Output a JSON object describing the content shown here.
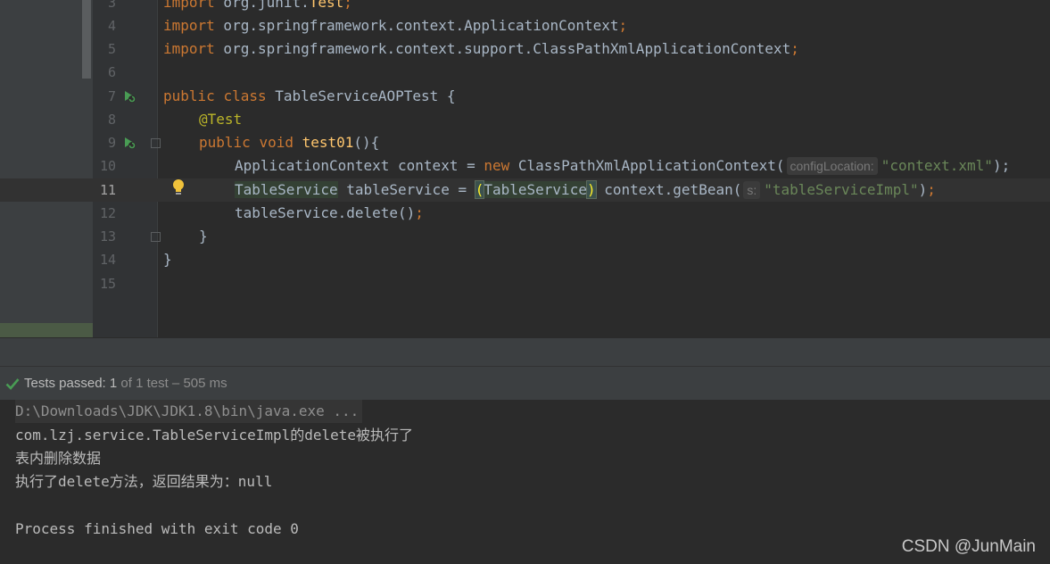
{
  "editor": {
    "line_numbers": [
      "3",
      "4",
      "5",
      "6",
      "7",
      "8",
      "9",
      "10",
      "11",
      "12",
      "13",
      "14",
      "15"
    ],
    "line3_kw": "import",
    "line3_pkg": " org.junit.",
    "line3_cls": "Test",
    "line3_semi": ";",
    "line4_kw": "import",
    "line4_rest": " org.springframework.context.ApplicationContext",
    "line4_semi": ";",
    "line5_kw": "import",
    "line5_rest": " org.springframework.context.support.ClassPathXmlApplicationContext",
    "line5_semi": ";",
    "line7_kw1": "public",
    "line7_kw2": "class",
    "line7_rest": " TableServiceAOPTest {",
    "line8_ann": "@Test",
    "line9_kw1": "public",
    "line9_kw2": "void",
    "line9_fn": "test01",
    "line9_rest": "(){",
    "line10_a": "ApplicationContext context = ",
    "line10_new": "new",
    "line10_b": " ClassPathXmlApplicationContext(",
    "line10_hint": "configLocation:",
    "line10_str": "\"context.xml\"",
    "line10_end": ");",
    "line11_type": "TableService",
    "line11_a": " tableService = ",
    "line11_open": "(",
    "line11_cast": "TableService",
    "line11_close": ")",
    "line11_b": " context.getBean(",
    "line11_hint": "s:",
    "line11_str": "\"tableServiceImpl\"",
    "line11_end": ")",
    "line11_semi": ";",
    "line12_a": "tableService.delete()",
    "line12_semi": ";",
    "line13": "}",
    "line14": "}"
  },
  "run": {
    "status_prefix": "Tests passed: ",
    "status_count": "1",
    "status_suffix": " of 1 test – 505 ms"
  },
  "console": {
    "cmd": "D:\\Downloads\\JDK\\JDK1.8\\bin\\java.exe ...",
    "out1": "com.lzj.service.TableServiceImpl的delete被执行了",
    "out2": "表内删除数据",
    "out3": "执行了delete方法，返回结果为：null",
    "out4": "Process finished with exit code 0"
  },
  "watermark": "CSDN @JunMain",
  "colors": {
    "keyword": "#cc7832",
    "annotation": "#bbb529",
    "function": "#ffc66d",
    "string": "#6a8759",
    "success": "#499c54"
  },
  "icons": {
    "run_gutter": "run-test-icon",
    "bulb": "intention-bulb-icon",
    "status": "check-icon"
  }
}
